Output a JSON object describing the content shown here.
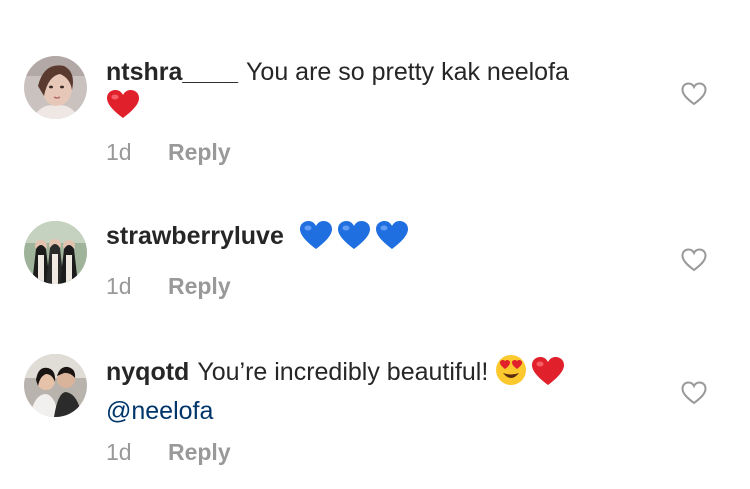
{
  "comments": [
    {
      "username": "ntshra____",
      "text": "You are so pretty kak neelofa",
      "emojis": [
        "red-heart"
      ],
      "time": "1d",
      "reply_label": "Reply"
    },
    {
      "username": "strawberryluve",
      "text": "",
      "emojis": [
        "blue-heart",
        "blue-heart",
        "blue-heart"
      ],
      "time": "1d",
      "reply_label": "Reply"
    },
    {
      "username": "nyqotd",
      "text": "You’re incredibly beautiful!",
      "emojis": [
        "heart-eyes-face",
        "red-heart"
      ],
      "mention": "@neelofa",
      "time": "1d",
      "reply_label": "Reply"
    }
  ],
  "colors": {
    "text": "#262626",
    "meta": "#999999",
    "mention": "#003569",
    "red_heart": "#e0202a",
    "blue_heart": "#1f6fe0"
  }
}
